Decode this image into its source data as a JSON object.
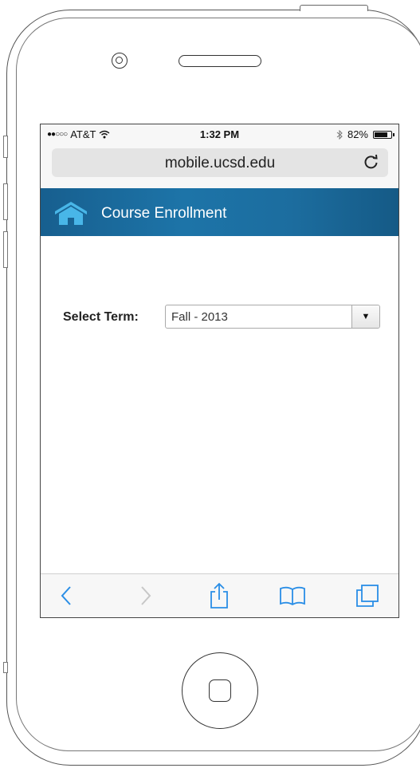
{
  "status_bar": {
    "carrier": "AT&T",
    "time": "1:32 PM",
    "battery": "82%",
    "battery_level": 0.82
  },
  "browser": {
    "url": "mobile.ucsd.edu"
  },
  "app_header": {
    "title": "Course Enrollment",
    "color": "#1d74a8",
    "icon": "home-icon"
  },
  "term_form": {
    "label": "Select Term:",
    "selected_value": "Fall - 2013"
  },
  "toolbar": {
    "buttons": [
      "back-icon",
      "forward-icon",
      "share-icon",
      "bookmarks-icon",
      "tabs-icon"
    ]
  },
  "accent_color": "#2a8ee6"
}
